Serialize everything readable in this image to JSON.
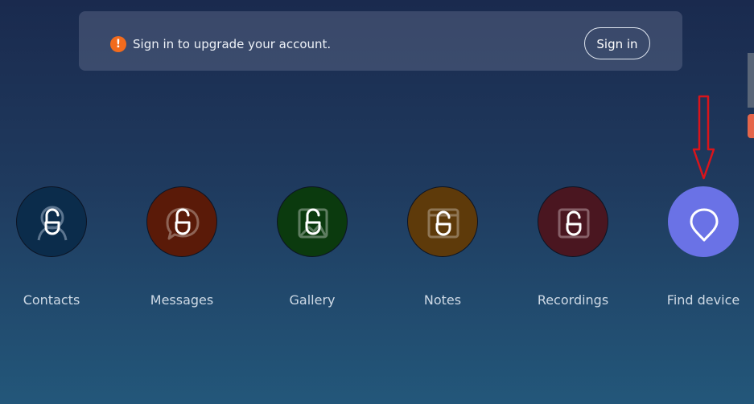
{
  "banner": {
    "icon": "warning-icon",
    "message": "Sign in to upgrade your account.",
    "sign_in_label": "Sign in"
  },
  "apps": [
    {
      "label": "Contacts",
      "icon": "contacts-lock-icon",
      "color": "#0b2c4b"
    },
    {
      "label": "Messages",
      "icon": "messages-lock-icon",
      "color": "#5a1a08"
    },
    {
      "label": "Gallery",
      "icon": "gallery-lock-icon",
      "color": "#0b3a0e"
    },
    {
      "label": "Notes",
      "icon": "notes-lock-icon",
      "color": "#5e3a0a"
    },
    {
      "label": "Recordings",
      "icon": "recordings-lock-icon",
      "color": "#4a1620"
    },
    {
      "label": "Find device",
      "icon": "location-pin-icon",
      "color": "#6a72e6"
    }
  ],
  "colors": {
    "annotation_arrow": "#d9141b",
    "warning": "#f26b1d",
    "side_tab_accent": "#e5664a"
  }
}
